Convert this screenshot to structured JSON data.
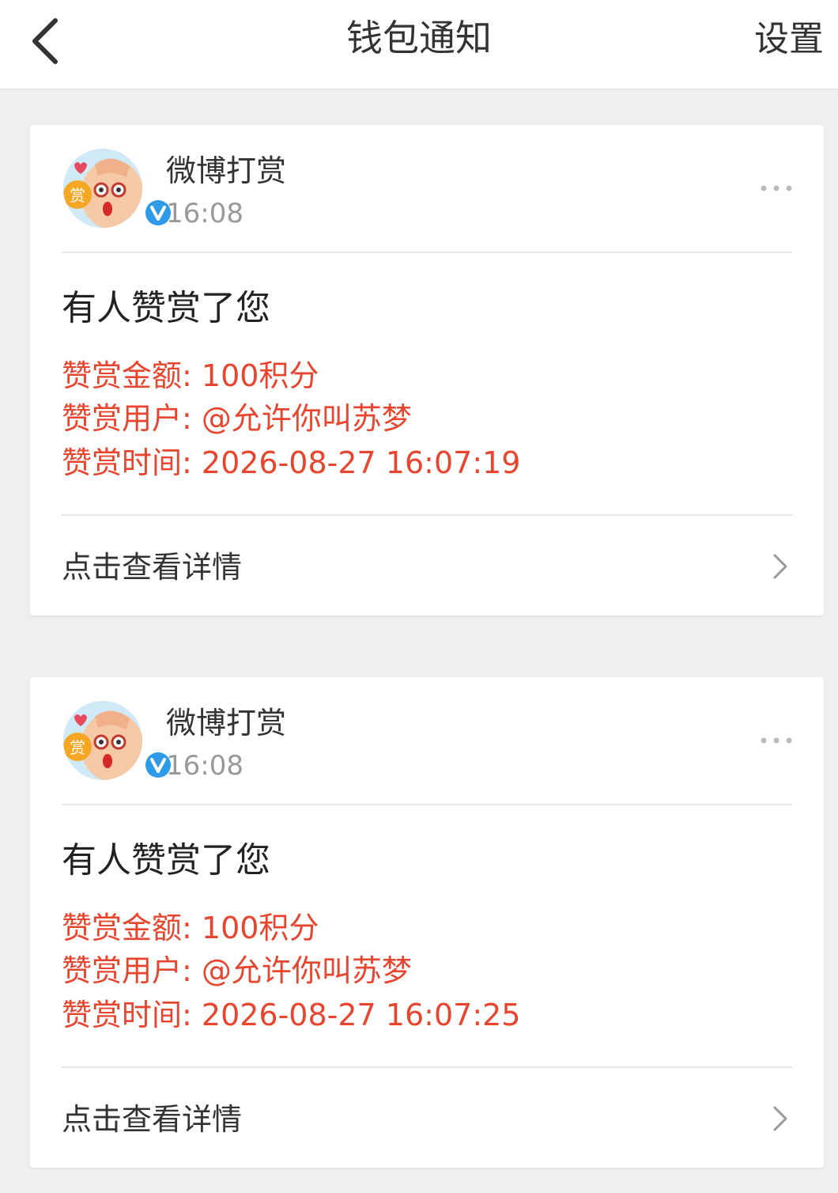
{
  "navbar": {
    "back_icon": "chevron-left-icon",
    "title": "钱包通知",
    "settings_label": "设置"
  },
  "notifications": [
    {
      "sender": "微博打赏",
      "time": "16:08",
      "avatar_badge": "赏",
      "title": "有人赞赏了您",
      "amount_label": "赞赏金额: ",
      "amount_value": "100积分",
      "user_label": "赞赏用户: ",
      "user_value": "@允许你叫苏梦",
      "time_label": "赞赏时间: ",
      "time_value": "2026-08-27 16:07:19",
      "footer_label": "点击查看详情"
    },
    {
      "sender": "微博打赏",
      "time": "16:08",
      "avatar_badge": "赏",
      "title": "有人赞赏了您",
      "amount_label": "赞赏金额: ",
      "amount_value": "100积分",
      "user_label": "赞赏用户: ",
      "user_value": "@允许你叫苏梦",
      "time_label": "赞赏时间: ",
      "time_value": "2026-08-27 16:07:25",
      "footer_label": "点击查看详情"
    }
  ],
  "colors": {
    "accent_red": "#e8452f",
    "verified_blue": "#2f9be8",
    "background": "#efefef"
  }
}
